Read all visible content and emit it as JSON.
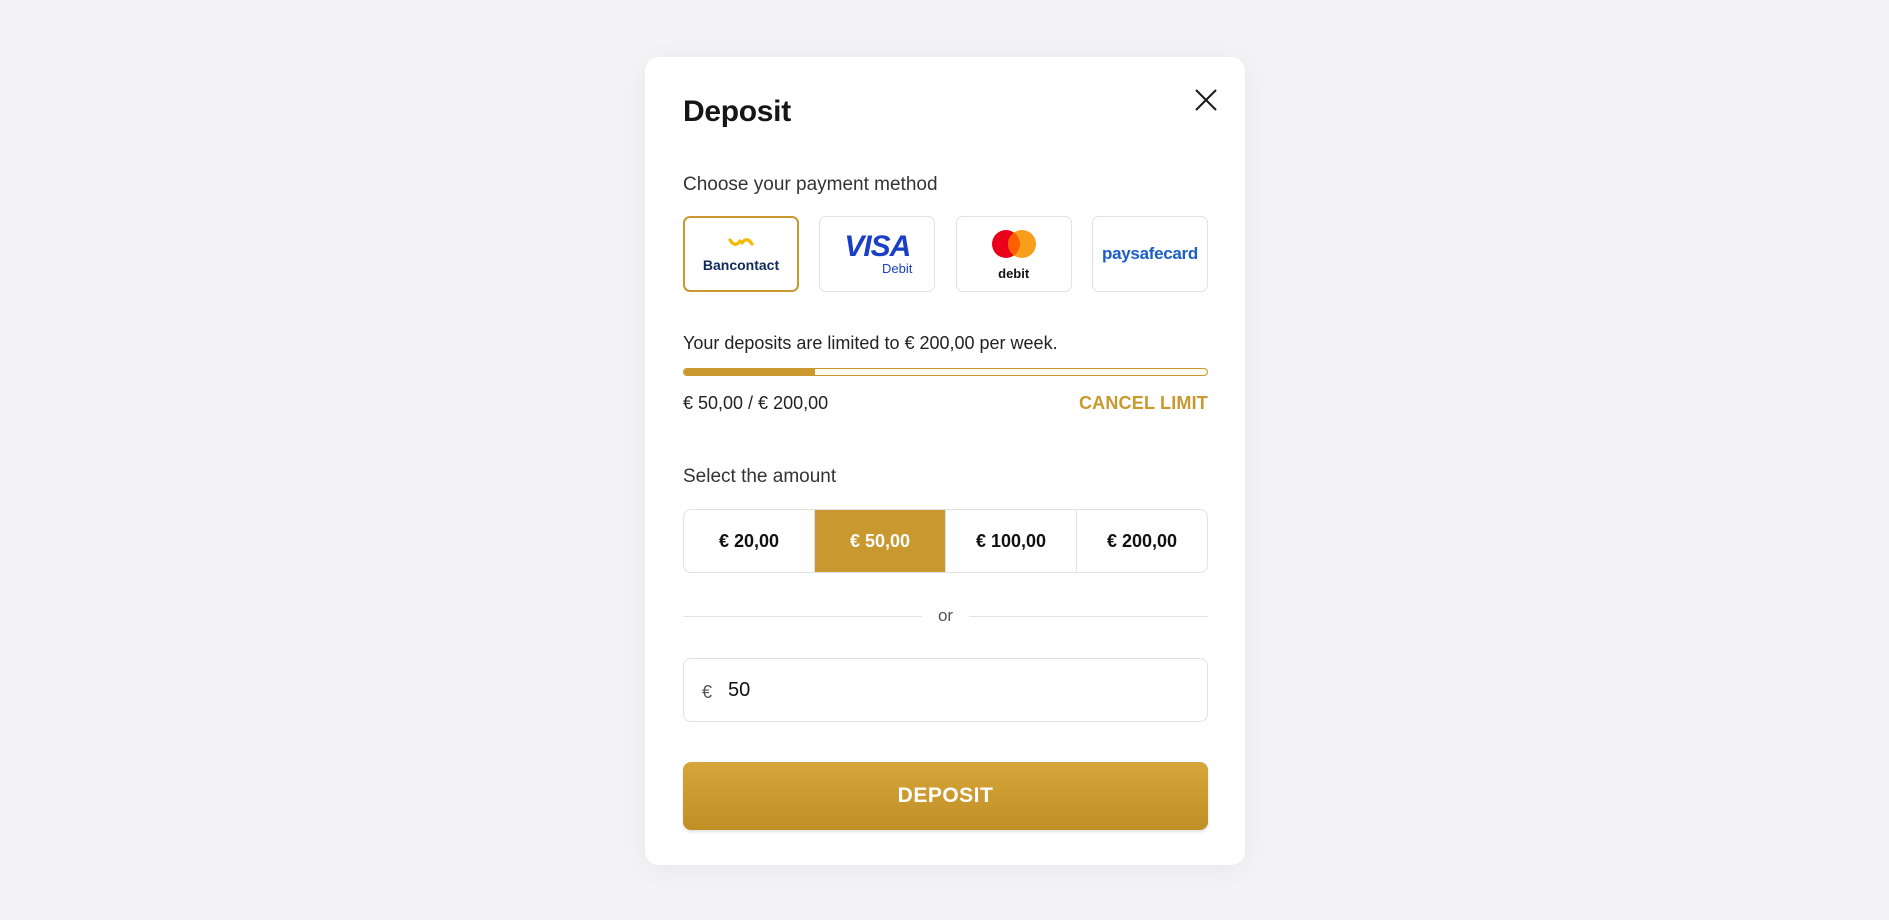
{
  "modal": {
    "title": "Deposit",
    "close_icon": "close-icon"
  },
  "payment": {
    "label": "Choose your payment method",
    "methods": [
      {
        "name": "Bancontact",
        "selected": true,
        "color": "#0f2a5c",
        "accent": "#f5b800"
      },
      {
        "name": "VISA",
        "sub": "Debit",
        "selected": false,
        "color": "#1a3fc7"
      },
      {
        "name": "debit",
        "selected": false,
        "color": "#111111"
      },
      {
        "name": "paysafecard",
        "selected": false,
        "color": "#1b5fc7"
      }
    ]
  },
  "limit": {
    "text": "Your deposits are limited to € 200,00 per week.",
    "values": "€ 50,00 / € 200,00",
    "progress": 0.25,
    "cancel_label": "CANCEL LIMIT"
  },
  "amount": {
    "label": "Select the amount",
    "options": [
      "€ 20,00",
      "€ 50,00",
      "€ 100,00",
      "€ 200,00"
    ],
    "selected_index": 1,
    "or_label": "or",
    "currency": "€",
    "input_value": "50"
  },
  "deposit_button_label": "DEPOSIT",
  "colors": {
    "accent": "#c9982e",
    "background": "#f4f4f6",
    "card": "#ffffff"
  }
}
